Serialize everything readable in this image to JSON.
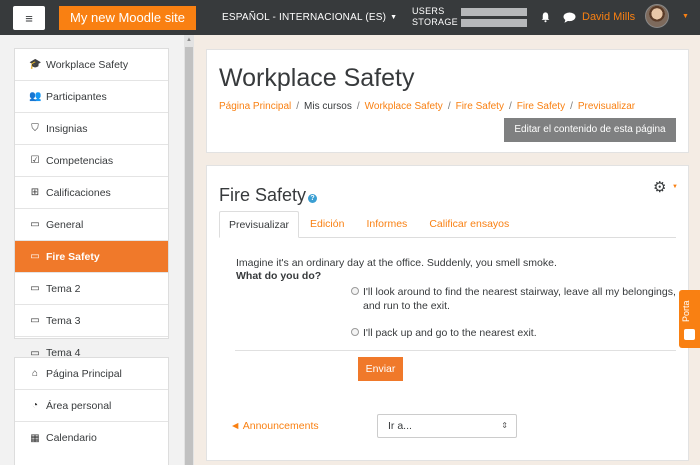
{
  "navbar": {
    "site_name": "My new Moodle site",
    "language": "ESPAÑOL - INTERNACIONAL (ES)",
    "storage_label_1": "USERS",
    "storage_label_2": "STORAGE",
    "username": "David Mills"
  },
  "drawer": {
    "items": [
      {
        "label": "Workplace Safety",
        "icon": "graduation-cap-icon",
        "glyph": "🎓"
      },
      {
        "label": "Participantes",
        "icon": "users-icon",
        "glyph": "👥"
      },
      {
        "label": "Insignias",
        "icon": "shield-icon",
        "glyph": "⛉"
      },
      {
        "label": "Competencias",
        "icon": "checkbox-icon",
        "glyph": "☑"
      },
      {
        "label": "Calificaciones",
        "icon": "table-icon",
        "glyph": "⊞"
      },
      {
        "label": "General",
        "icon": "folder-icon",
        "glyph": "▭"
      },
      {
        "label": "Fire Safety",
        "icon": "folder-icon",
        "glyph": "▭"
      },
      {
        "label": "Tema 2",
        "icon": "folder-icon",
        "glyph": "▭"
      },
      {
        "label": "Tema 3",
        "icon": "folder-icon",
        "glyph": "▭"
      },
      {
        "label": "Tema 4",
        "icon": "folder-icon",
        "glyph": "▭"
      }
    ],
    "items2": [
      {
        "label": "Página Principal",
        "icon": "home-icon",
        "glyph": "⌂"
      },
      {
        "label": "Área personal",
        "icon": "dashboard-icon",
        "glyph": "◔"
      },
      {
        "label": "Calendario",
        "icon": "calendar-icon",
        "glyph": "▦"
      }
    ],
    "active_index": 6
  },
  "header": {
    "title": "Workplace Safety",
    "breadcrumb": [
      "Página Principal",
      "Mis cursos",
      "Workplace Safety",
      "Fire Safety",
      "Fire Safety",
      "Previsualizar"
    ],
    "edit_button": "Editar el contenido de esta página"
  },
  "quiz": {
    "title": "Fire Safety",
    "help": "?",
    "tabs": [
      "Previsualizar",
      "Edición",
      "Informes",
      "Calificar ensayos"
    ],
    "prompt": "Imagine it's an ordinary day at the office. Suddenly, you smell smoke.",
    "question": "What do you do?",
    "option1": "I'll look around to find the nearest stairway, leave all my belongings, and run to the exit.",
    "option2": "I'll pack up and go to the nearest exit.",
    "submit": "Enviar",
    "announcements": "Announcements",
    "jump_select": "Ir a..."
  },
  "side_tab": {
    "label": "Porta"
  },
  "colors": {
    "accent": "#f98012",
    "navbar": "#373a3c",
    "button_gray": "#7f8081"
  }
}
